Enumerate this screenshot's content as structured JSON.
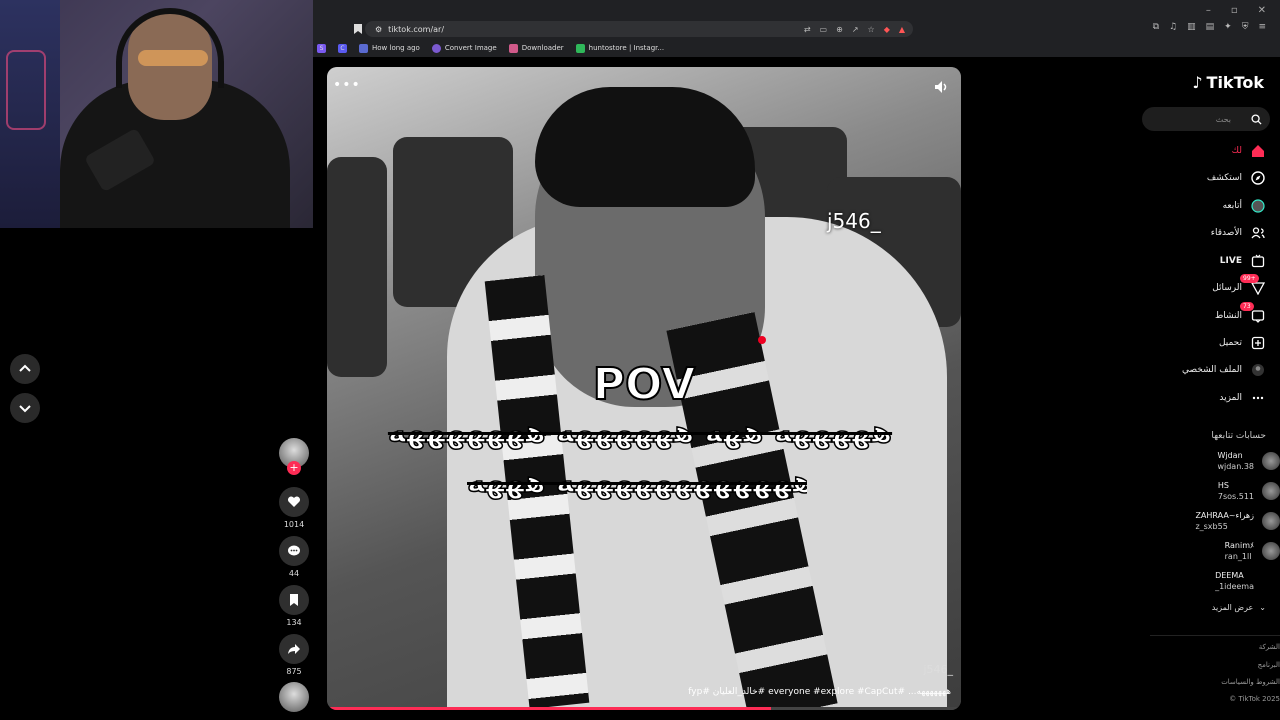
{
  "browser": {
    "url": "tiktok.com/ar/",
    "window_controls": [
      "–",
      "▫",
      "✕"
    ],
    "bookmarks": [
      {
        "label": "How long ago",
        "color": "#5a6ad0"
      },
      {
        "label": "Convert Image",
        "color": "#7b5ad0"
      },
      {
        "label": "Downloader",
        "color": "#d05a8a"
      },
      {
        "label": "huntostore | Instagr...",
        "color": "#2fb85a"
      }
    ],
    "bookmark_icons": [
      {
        "label": "S",
        "color": "#7a5af0"
      },
      {
        "label": "C",
        "color": "#5a5af0"
      }
    ]
  },
  "video": {
    "watermark_top": "j546_",
    "overlay_title": "POV",
    "overlay_line1": "هههههه ههه ههههههه هههههههه",
    "overlay_line2": "ههههههههههههه هههه",
    "watermark_bottom": "j546_",
    "caption": "هههههههه... #everyone #explore #CapCut #خالد_العليان #fyp",
    "more_dots": "•••",
    "progress": 0.7
  },
  "actions": {
    "likes": "1014",
    "comments": "44",
    "saves": "134",
    "shares": "875",
    "follow_plus": "+"
  },
  "sidebar": {
    "logo": "TikTok",
    "search_placeholder": "بحث",
    "nav": [
      {
        "label": "لك",
        "icon": "home-icon",
        "active": true
      },
      {
        "label": "استكشف",
        "icon": "compass-icon"
      },
      {
        "label": "أتابعه",
        "icon": "following-avatar-icon"
      },
      {
        "label": "الأصدقاء",
        "icon": "friends-icon"
      },
      {
        "label": "LIVE",
        "icon": "live-icon"
      },
      {
        "label": "الرسائل",
        "icon": "messages-icon",
        "badge": "99+"
      },
      {
        "label": "النشاط",
        "icon": "activity-icon",
        "badge": "73"
      },
      {
        "label": "تحميل",
        "icon": "upload-icon"
      },
      {
        "label": "الملف الشخصي",
        "icon": "profile-icon"
      },
      {
        "label": "المزيد",
        "icon": "more-icon"
      }
    ],
    "following_title": "حسابات تتابعها",
    "following": [
      {
        "name": "Wjdan",
        "user": "wjdan.38"
      },
      {
        "name": "HS",
        "user": "7sos.511"
      },
      {
        "name": "ZAHRAA~زهراء",
        "user": "z_sxb55"
      },
      {
        "name": "Ranimﾒ",
        "user": "ran_1ll"
      },
      {
        "name": "DEEMA",
        "user": "_1ideema"
      }
    ],
    "see_more": "عرض المزيد",
    "footer": [
      "الشركة",
      "البرنامج",
      "الشروط والسياسات",
      "TikTok 2025 ©"
    ]
  },
  "colors": {
    "accent": "#fe2c55",
    "background": "#000000"
  }
}
